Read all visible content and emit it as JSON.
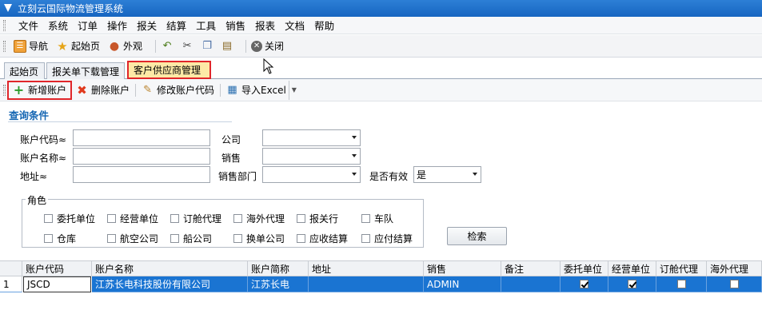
{
  "window": {
    "title": "立刻云国际物流管理系统"
  },
  "menu": [
    "文件",
    "系统",
    "订单",
    "操作",
    "报关",
    "结算",
    "工具",
    "销售",
    "报表",
    "文档",
    "帮助"
  ],
  "toolbar": {
    "nav": "导航",
    "home": "起始页",
    "appearance": "外观",
    "close": "关闭"
  },
  "tabs": [
    "起始页",
    "报关单下载管理",
    "客户供应商管理"
  ],
  "actions": {
    "add": "新增账户",
    "delete": "删除账户",
    "modify": "修改账户代码",
    "import": "导入Excel"
  },
  "query": {
    "title": "查询条件",
    "code_label": "账户代码≈",
    "name_label": "账户名称≈",
    "address_label": "地址≈",
    "company_label": "公司",
    "sales_label": "销售",
    "dept_label": "销售部门",
    "valid_label": "是否有效",
    "valid_value": "是",
    "code_value": "",
    "name_value": "",
    "address_value": "",
    "company_value": "",
    "sales_value": "",
    "dept_value": ""
  },
  "roles": {
    "legend": "角色",
    "items": [
      "委托单位",
      "经营单位",
      "订舱代理",
      "海外代理",
      "报关行",
      "车队",
      "仓库",
      "航空公司",
      "船公司",
      "换单公司",
      "应收结算",
      "应付结算"
    ]
  },
  "search_button": "检索",
  "grid": {
    "headers": [
      "账户代码",
      "账户名称",
      "账户简称",
      "地址",
      "销售",
      "备注",
      "委托单位",
      "经营单位",
      "订舱代理",
      "海外代理"
    ],
    "rows": [
      {
        "num": "1",
        "code": "JSCD",
        "name": "江苏长电科技股份有限公司",
        "short": "江苏长电",
        "address": "",
        "sales": "ADMIN",
        "note": "",
        "entrust": true,
        "operate": true,
        "booking": false,
        "overseas": false
      }
    ]
  }
}
